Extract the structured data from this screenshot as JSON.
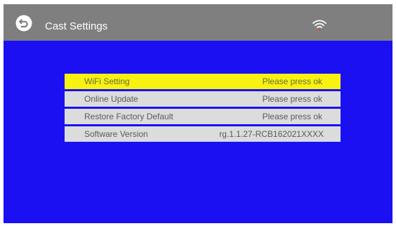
{
  "header": {
    "title": "Cast Settings",
    "back_icon": "back-arrow-icon",
    "status_icon": "wifi-icon"
  },
  "menu": {
    "items": [
      {
        "label": "WiFi Setting",
        "value": "Please press ok",
        "selected": true
      },
      {
        "label": "Online Update",
        "value": "Please press ok",
        "selected": false
      },
      {
        "label": "Restore Factory Default",
        "value": "Please press ok",
        "selected": false
      },
      {
        "label": "Software Version",
        "value": "rg.1.1.27-RCB162021XXXX",
        "selected": false
      }
    ]
  },
  "colors": {
    "background": "#1a10f2",
    "header": "#7f7f7f",
    "item": "#dcdcdc",
    "selected": "#f7f20f"
  }
}
